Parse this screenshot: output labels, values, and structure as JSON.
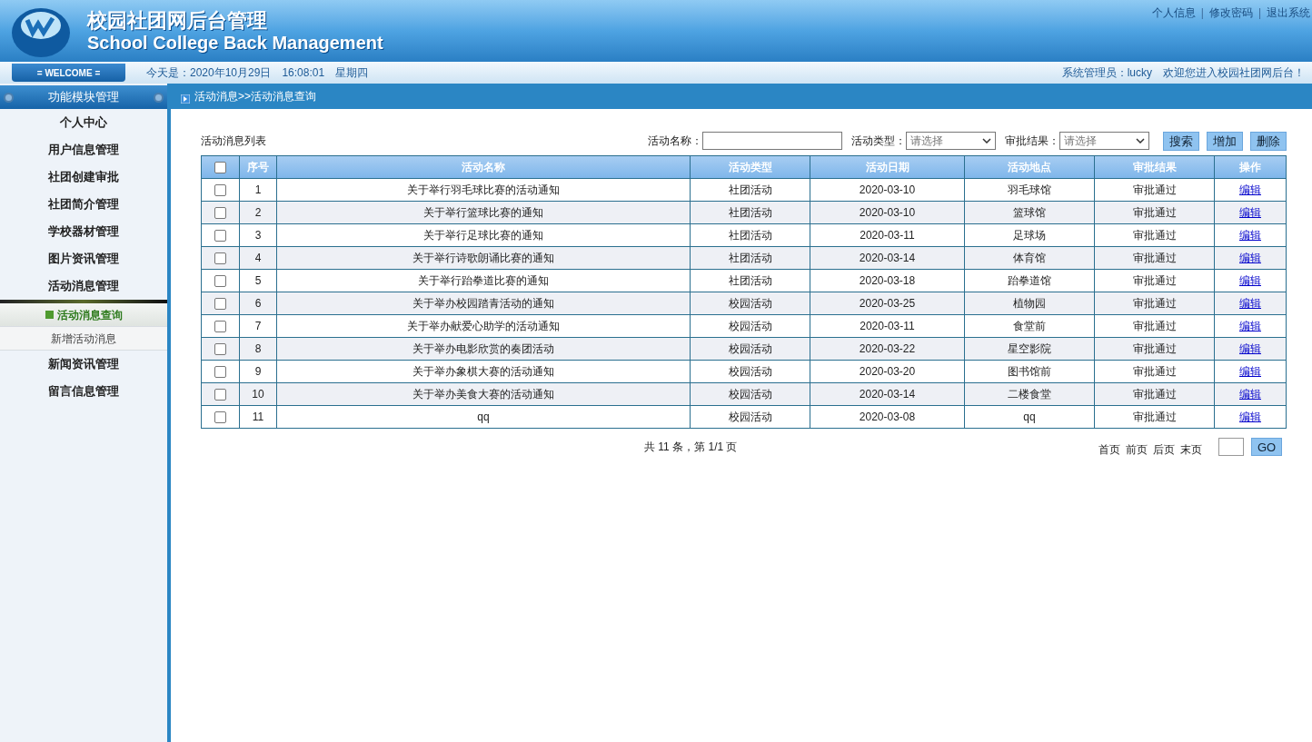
{
  "header": {
    "title": "校园社团网后台管理",
    "subtitle": "School College Back Management",
    "links": [
      "个人信息",
      "修改密码",
      "退出系统"
    ],
    "separator": "|"
  },
  "welcome_bar": {
    "badge": "= WELCOME =",
    "date": "今天是：2020年10月29日　16:08:01　星期四",
    "user": "系统管理员：lucky　欢迎您进入校园社团网后台！"
  },
  "sidebar": {
    "title": "功能模块管理",
    "items": [
      {
        "label": "个人中心"
      },
      {
        "label": "用户信息管理"
      },
      {
        "label": "社团创建审批"
      },
      {
        "label": "社团简介管理"
      },
      {
        "label": "学校器材管理"
      },
      {
        "label": "图片资讯管理"
      },
      {
        "label": "活动消息管理",
        "expanded": true,
        "children": [
          {
            "label": "活动消息查询",
            "selected": true
          },
          {
            "label": "新增活动消息",
            "selected": false
          }
        ]
      },
      {
        "label": "新闻资讯管理"
      },
      {
        "label": "留言信息管理"
      }
    ]
  },
  "breadcrumb": "活动消息>>活动消息查询",
  "list_title": "活动消息列表",
  "filters": [
    {
      "kind": "input",
      "label": "活动名称："
    },
    {
      "kind": "select",
      "label": "活动类型：",
      "placeholder": "请选择"
    },
    {
      "kind": "select",
      "label": "审批结果：",
      "placeholder": "请选择"
    }
  ],
  "buttons": [
    "搜索",
    "增加",
    "删除"
  ],
  "table": {
    "select_all_checked": false,
    "columns": [
      "序号",
      "活动名称",
      "活动类型",
      "活动日期",
      "活动地点",
      "审批结果",
      "操作"
    ],
    "rows": [
      {
        "checked": false,
        "cells": [
          "1",
          "关于举行羽毛球比赛的活动通知",
          "社团活动",
          "2020-03-10",
          "羽毛球馆",
          "审批通过",
          "编辑"
        ]
      },
      {
        "checked": false,
        "cells": [
          "2",
          "关于举行篮球比赛的通知",
          "社团活动",
          "2020-03-10",
          "篮球馆",
          "审批通过",
          "编辑"
        ]
      },
      {
        "checked": false,
        "cells": [
          "3",
          "关于举行足球比赛的通知",
          "社团活动",
          "2020-03-11",
          "足球场",
          "审批通过",
          "编辑"
        ]
      },
      {
        "checked": false,
        "cells": [
          "4",
          "关于举行诗歌朗诵比赛的通知",
          "社团活动",
          "2020-03-14",
          "体育馆",
          "审批通过",
          "编辑"
        ]
      },
      {
        "checked": false,
        "cells": [
          "5",
          "关于举行跆拳道比赛的通知",
          "社团活动",
          "2020-03-18",
          "跆拳道馆",
          "审批通过",
          "编辑"
        ]
      },
      {
        "checked": false,
        "cells": [
          "6",
          "关于举办校园踏青活动的通知",
          "校园活动",
          "2020-03-25",
          "植物园",
          "审批通过",
          "编辑"
        ]
      },
      {
        "checked": false,
        "cells": [
          "7",
          "关于举办献爱心助学的活动通知",
          "校园活动",
          "2020-03-11",
          "食堂前",
          "审批通过",
          "编辑"
        ]
      },
      {
        "checked": false,
        "cells": [
          "8",
          "关于举办电影欣赏的奏团活动",
          "校园活动",
          "2020-03-22",
          "星空影院",
          "审批通过",
          "编辑"
        ]
      },
      {
        "checked": false,
        "cells": [
          "9",
          "关于举办象棋大赛的活动通知",
          "校园活动",
          "2020-03-20",
          "图书馆前",
          "审批通过",
          "编辑"
        ]
      },
      {
        "checked": false,
        "cells": [
          "10",
          "关于举办美食大赛的活动通知",
          "校园活动",
          "2020-03-14",
          "二楼食堂",
          "审批通过",
          "编辑"
        ]
      },
      {
        "checked": false,
        "cells": [
          "11",
          "qq",
          "校园活动",
          "2020-03-08",
          "qq",
          "审批通过",
          "编辑"
        ]
      }
    ]
  },
  "pagination": {
    "summary": "共 11 条，第 1/1 页",
    "links": [
      "首页",
      "前页",
      "后页",
      "末页"
    ],
    "go": "GO"
  }
}
